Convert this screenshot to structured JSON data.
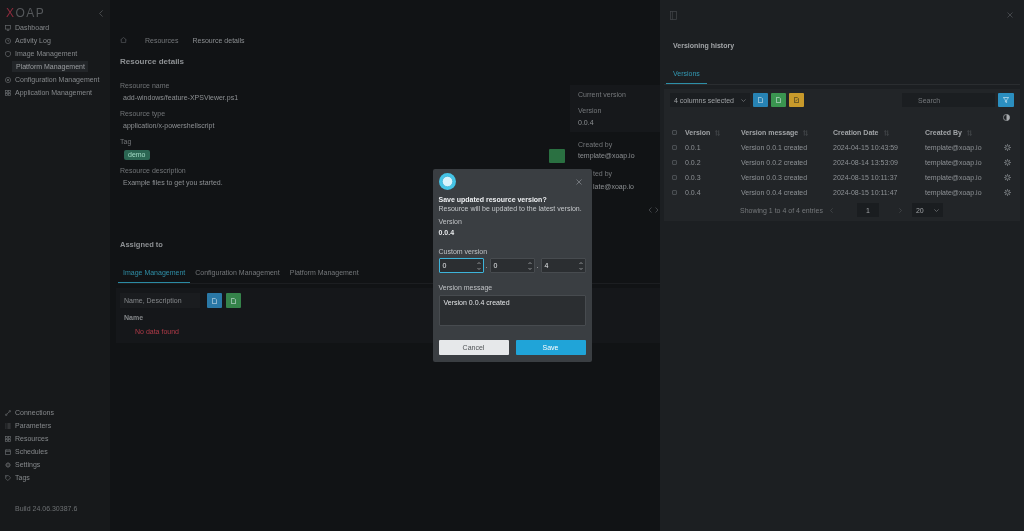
{
  "sidebar": {
    "logo": "XOAP",
    "top_items": [
      {
        "label": "Dashboard",
        "selected": false
      },
      {
        "label": "Activity Log",
        "selected": false
      },
      {
        "label": "Image Management",
        "selected": false
      },
      {
        "label": "Platform Management",
        "selected": true
      },
      {
        "label": "Configuration Management",
        "selected": false
      },
      {
        "label": "Application Management",
        "selected": false
      }
    ],
    "bottom_items": [
      {
        "label": "Connections",
        "selected": false
      },
      {
        "label": "Parameters",
        "selected": false
      },
      {
        "label": "Resources",
        "selected": false
      },
      {
        "label": "Schedules",
        "selected": false
      },
      {
        "label": "Settings",
        "selected": false
      },
      {
        "label": "Tags",
        "selected": false
      }
    ],
    "build": "Build 24.06.30387.6"
  },
  "breadcrumb": [
    "Resources",
    "Resource details"
  ],
  "details": {
    "title": "Resource details",
    "fields": [
      {
        "kind": "text",
        "label": "Resource name",
        "value": "add-windows/feature-XPSViewer.ps1"
      },
      {
        "kind": "text",
        "label": "Resource type",
        "value": "application/x-powershellscript"
      },
      {
        "kind": "tag",
        "label": "Tag",
        "value": "demo"
      },
      {
        "kind": "text",
        "label": "Resource description",
        "value": "Example files to get you started."
      }
    ]
  },
  "version_info": {
    "title": "Current version",
    "label": "Version",
    "value": "0.0.4",
    "created_by_label": "Created by",
    "created_by": "template@xoap.io",
    "updated_by_label": "ted by",
    "updated_by": "late@xoap.io"
  },
  "assigned": {
    "title": "Assigned to",
    "tabs": [
      {
        "label": "Image Management",
        "selected": true
      },
      {
        "label": "Configuration Management",
        "selected": false
      },
      {
        "label": "Platform Management",
        "selected": false
      }
    ],
    "search": {
      "placeholder": "Name, Description"
    },
    "tool_buttons": [
      {
        "color": "#2a78a6"
      },
      {
        "color": "#35834a"
      }
    ],
    "column": "Name",
    "empty": "No data found"
  },
  "history": {
    "title": "Versioning history",
    "tabs": [
      {
        "label": "Versions",
        "selected": true
      }
    ],
    "columns_select": "4 columns selected",
    "tool_buttons": [
      {
        "color": "#2783b4"
      },
      {
        "color": "#3a9550"
      },
      {
        "color": "#c89a2b"
      }
    ],
    "search": {
      "placeholder": "Search"
    },
    "header_checked": false,
    "columns": [
      "Version",
      "Version message",
      "Creation Date",
      "Created By"
    ],
    "rows": [
      {
        "checked": false,
        "cells": [
          "0.0.1",
          "Version 0.0.1 created",
          "2024-04-15 10:43:59",
          "template@xoap.io"
        ]
      },
      {
        "checked": false,
        "cells": [
          "0.0.2",
          "Version 0.0.2 created",
          "2024-08-14 13:53:09",
          "template@xoap.io"
        ]
      },
      {
        "checked": false,
        "cells": [
          "0.0.3",
          "Version 0.0.3 created",
          "2024-08-15 10:11:37",
          "template@xoap.io"
        ]
      },
      {
        "checked": false,
        "cells": [
          "0.0.4",
          "Version 0.0.4 created",
          "2024-08-15 10:11:47",
          "template@xoap.io"
        ]
      }
    ],
    "pagination": {
      "summary": "Showing 1 to 4 of 4 entries",
      "page": "1",
      "page_size": "20"
    }
  },
  "dialog": {
    "title": "Save updated resource version?",
    "subtitle": "Resource will be updated to the latest version.",
    "version_label": "Version",
    "version": "0.0.4",
    "custom_label": "Custom version",
    "parts": [
      {
        "value": "0",
        "focused": true
      },
      {
        "value": "0",
        "focused": false
      },
      {
        "value": "4",
        "focused": false
      }
    ],
    "separators": [
      ".",
      "."
    ],
    "message_label": "Version message",
    "message": "Version 0.0.4 created",
    "buttons": [
      {
        "label": "Cancel",
        "kind": "secondary"
      },
      {
        "label": "Save",
        "kind": "primary"
      }
    ]
  }
}
